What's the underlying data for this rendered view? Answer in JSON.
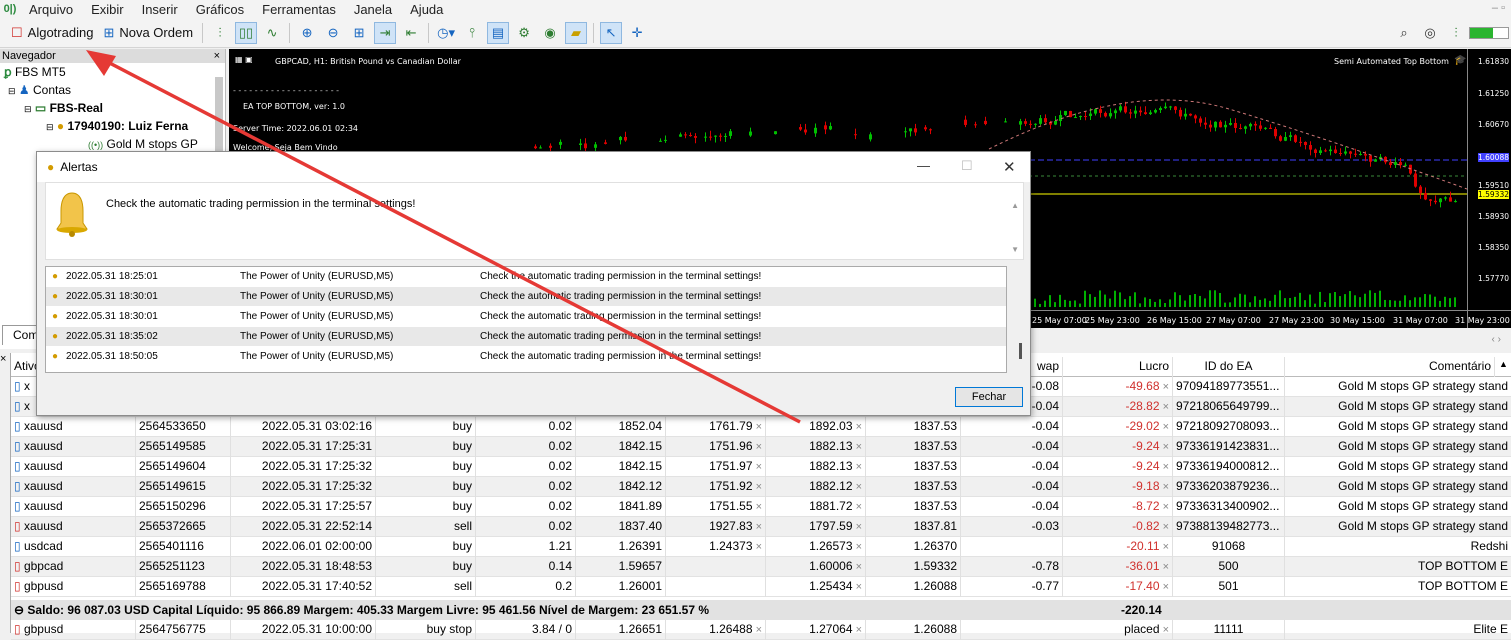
{
  "menu": [
    "Arquivo",
    "Exibir",
    "Inserir",
    "Gráficos",
    "Ferramentas",
    "Janela",
    "Ajuda"
  ],
  "toolbar": {
    "algotrading": "Algotrading",
    "nova_ordem": "Nova Ordem"
  },
  "navigator": {
    "title": "Navegador",
    "items": [
      "FBS MT5",
      "Contas",
      "FBS-Real",
      "17940190: Luiz Ferna",
      "Gold M stops GP"
    ],
    "tab": "Com"
  },
  "chart": {
    "symbol_title": "GBPCAD, H1:  British Pound vs Canadian Dollar",
    "ea_name": "EA TOP BOTTOM, ver: 1.0",
    "server_time": "Server Time: 2022.06.01 02:34",
    "welcome": "Welcome, Seja Bem Vindo",
    "ea_label": "Semi Automated Top Bottom",
    "prices": [
      "1.61830",
      "1.61250",
      "1.60670",
      "1.60088",
      "1.59510",
      "1.59332",
      "1.58930",
      "1.58350",
      "1.57770"
    ],
    "times": [
      "25 May 07:00",
      "25 May 23:00",
      "26 May 15:00",
      "27 May 07:00",
      "27 May 23:00",
      "30 May 15:00",
      "31 May 07:00",
      "31 May 23:00"
    ],
    "colors": {
      "bull": "#00c000",
      "bear": "#e00000",
      "bid": "#ffff00",
      "entry": "#4040ff"
    }
  },
  "alerts": {
    "title": "Alertas",
    "message": "Check the automatic trading permission in the terminal settings!",
    "rows": [
      {
        "time": "2022.05.31 18:25:01",
        "ea": "The Power of Unity (EURUSD,M5)",
        "msg": "Check the automatic trading permission in the terminal settings!"
      },
      {
        "time": "2022.05.31 18:30:01",
        "ea": "The Power of Unity (EURUSD,M5)",
        "msg": "Check the automatic trading permission in the terminal settings!"
      },
      {
        "time": "2022.05.31 18:30:01",
        "ea": "The Power of Unity (EURUSD,M5)",
        "msg": "Check the automatic trading permission in the terminal settings!"
      },
      {
        "time": "2022.05.31 18:35:02",
        "ea": "The Power of Unity (EURUSD,M5)",
        "msg": "Check the automatic trading permission in the terminal settings!"
      },
      {
        "time": "2022.05.31 18:50:05",
        "ea": "The Power of Unity (EURUSD,M5)",
        "msg": "Check the automatic trading permission in the terminal settings!"
      }
    ],
    "close": "Fechar"
  },
  "trade": {
    "headers": {
      "ativo": "Ativo",
      "swap": "wap",
      "lucro": "Lucro",
      "id": "ID do EA",
      "comentario": "Comentário"
    },
    "rows": [
      {
        "sym": "x",
        "ticket": "",
        "time": "",
        "type": "",
        "vol": "",
        "price": "",
        "sl": "",
        "tp": "",
        "cur": "",
        "swap": "-0.08",
        "profit": "-49.68",
        "id": "97094189773551...",
        "comment": "Gold M stops GP strategy stand",
        "sell": false
      },
      {
        "sym": "x",
        "ticket": "",
        "time": "",
        "type": "",
        "vol": "",
        "price": "",
        "sl": "",
        "tp": "",
        "cur": "",
        "swap": "-0.04",
        "profit": "-28.82",
        "id": "97218065649799...",
        "comment": "Gold M stops GP strategy stand",
        "sell": false
      },
      {
        "sym": "xauusd",
        "ticket": "2564533650",
        "time": "2022.05.31 03:02:16",
        "type": "buy",
        "vol": "0.02",
        "price": "1852.04",
        "sl": "1761.79",
        "tp": "1892.03",
        "cur": "1837.53",
        "swap": "-0.04",
        "profit": "-29.02",
        "id": "97218092708093...",
        "comment": "Gold M stops GP strategy stand",
        "sell": false
      },
      {
        "sym": "xauusd",
        "ticket": "2565149585",
        "time": "2022.05.31 17:25:31",
        "type": "buy",
        "vol": "0.02",
        "price": "1842.15",
        "sl": "1751.96",
        "tp": "1882.13",
        "cur": "1837.53",
        "swap": "-0.04",
        "profit": "-9.24",
        "id": "97336191423831...",
        "comment": "Gold M stops GP strategy stand",
        "sell": false
      },
      {
        "sym": "xauusd",
        "ticket": "2565149604",
        "time": "2022.05.31 17:25:32",
        "type": "buy",
        "vol": "0.02",
        "price": "1842.15",
        "sl": "1751.97",
        "tp": "1882.13",
        "cur": "1837.53",
        "swap": "-0.04",
        "profit": "-9.24",
        "id": "97336194000812...",
        "comment": "Gold M stops GP strategy stand",
        "sell": false
      },
      {
        "sym": "xauusd",
        "ticket": "2565149615",
        "time": "2022.05.31 17:25:32",
        "type": "buy",
        "vol": "0.02",
        "price": "1842.12",
        "sl": "1751.92",
        "tp": "1882.12",
        "cur": "1837.53",
        "swap": "-0.04",
        "profit": "-9.18",
        "id": "97336203879236...",
        "comment": "Gold M stops GP strategy stand",
        "sell": false
      },
      {
        "sym": "xauusd",
        "ticket": "2565150296",
        "time": "2022.05.31 17:25:57",
        "type": "buy",
        "vol": "0.02",
        "price": "1841.89",
        "sl": "1751.55",
        "tp": "1881.72",
        "cur": "1837.53",
        "swap": "-0.04",
        "profit": "-8.72",
        "id": "97336313400902...",
        "comment": "Gold M stops GP strategy stand",
        "sell": false
      },
      {
        "sym": "xauusd",
        "ticket": "2565372665",
        "time": "2022.05.31 22:52:14",
        "type": "sell",
        "vol": "0.02",
        "price": "1837.40",
        "sl": "1927.83",
        "tp": "1797.59",
        "cur": "1837.81",
        "swap": "-0.03",
        "profit": "-0.82",
        "id": "97388139482773...",
        "comment": "Gold M stops GP strategy stand",
        "sell": true
      },
      {
        "sym": "usdcad",
        "ticket": "2565401116",
        "time": "2022.06.01 02:00:00",
        "type": "buy",
        "vol": "1.21",
        "price": "1.26391",
        "sl": "1.24373",
        "tp": "1.26573",
        "cur": "1.26370",
        "swap": "",
        "profit": "-20.11",
        "id": "91068",
        "comment": "Redshi",
        "sell": false
      },
      {
        "sym": "gbpcad",
        "ticket": "2565251123",
        "time": "2022.05.31 18:48:53",
        "type": "buy",
        "vol": "0.14",
        "price": "1.59657",
        "sl": "",
        "tp": "1.60006",
        "cur": "1.59332",
        "swap": "-0.78",
        "profit": "-36.01",
        "id": "500",
        "comment": "TOP BOTTOM E",
        "sell": true
      },
      {
        "sym": "gbpusd",
        "ticket": "2565169788",
        "time": "2022.05.31 17:40:52",
        "type": "sell",
        "vol": "0.2",
        "price": "1.26001",
        "sl": "",
        "tp": "1.25434",
        "cur": "1.26088",
        "swap": "-0.77",
        "profit": "-17.40",
        "id": "501",
        "comment": "TOP BOTTOM E",
        "sell": true
      }
    ],
    "balance": "⊖ Saldo: 96 087.03 USD  Capital Líquido: 95 866.89  Margem: 405.33  Margem Livre: 95 461.56  Nível de Margem: 23 651.57 %",
    "balance_profit": "-220.14",
    "pending": {
      "sym": "gbpusd",
      "ticket": "2564756775",
      "time": "2022.05.31 10:00:00",
      "type": "buy stop",
      "vol": "3.84 / 0",
      "price": "1.26651",
      "sl": "1.26488",
      "tp": "1.27064",
      "cur": "1.26088",
      "profit": "placed",
      "id": "11111",
      "comment": "Elite E"
    }
  }
}
